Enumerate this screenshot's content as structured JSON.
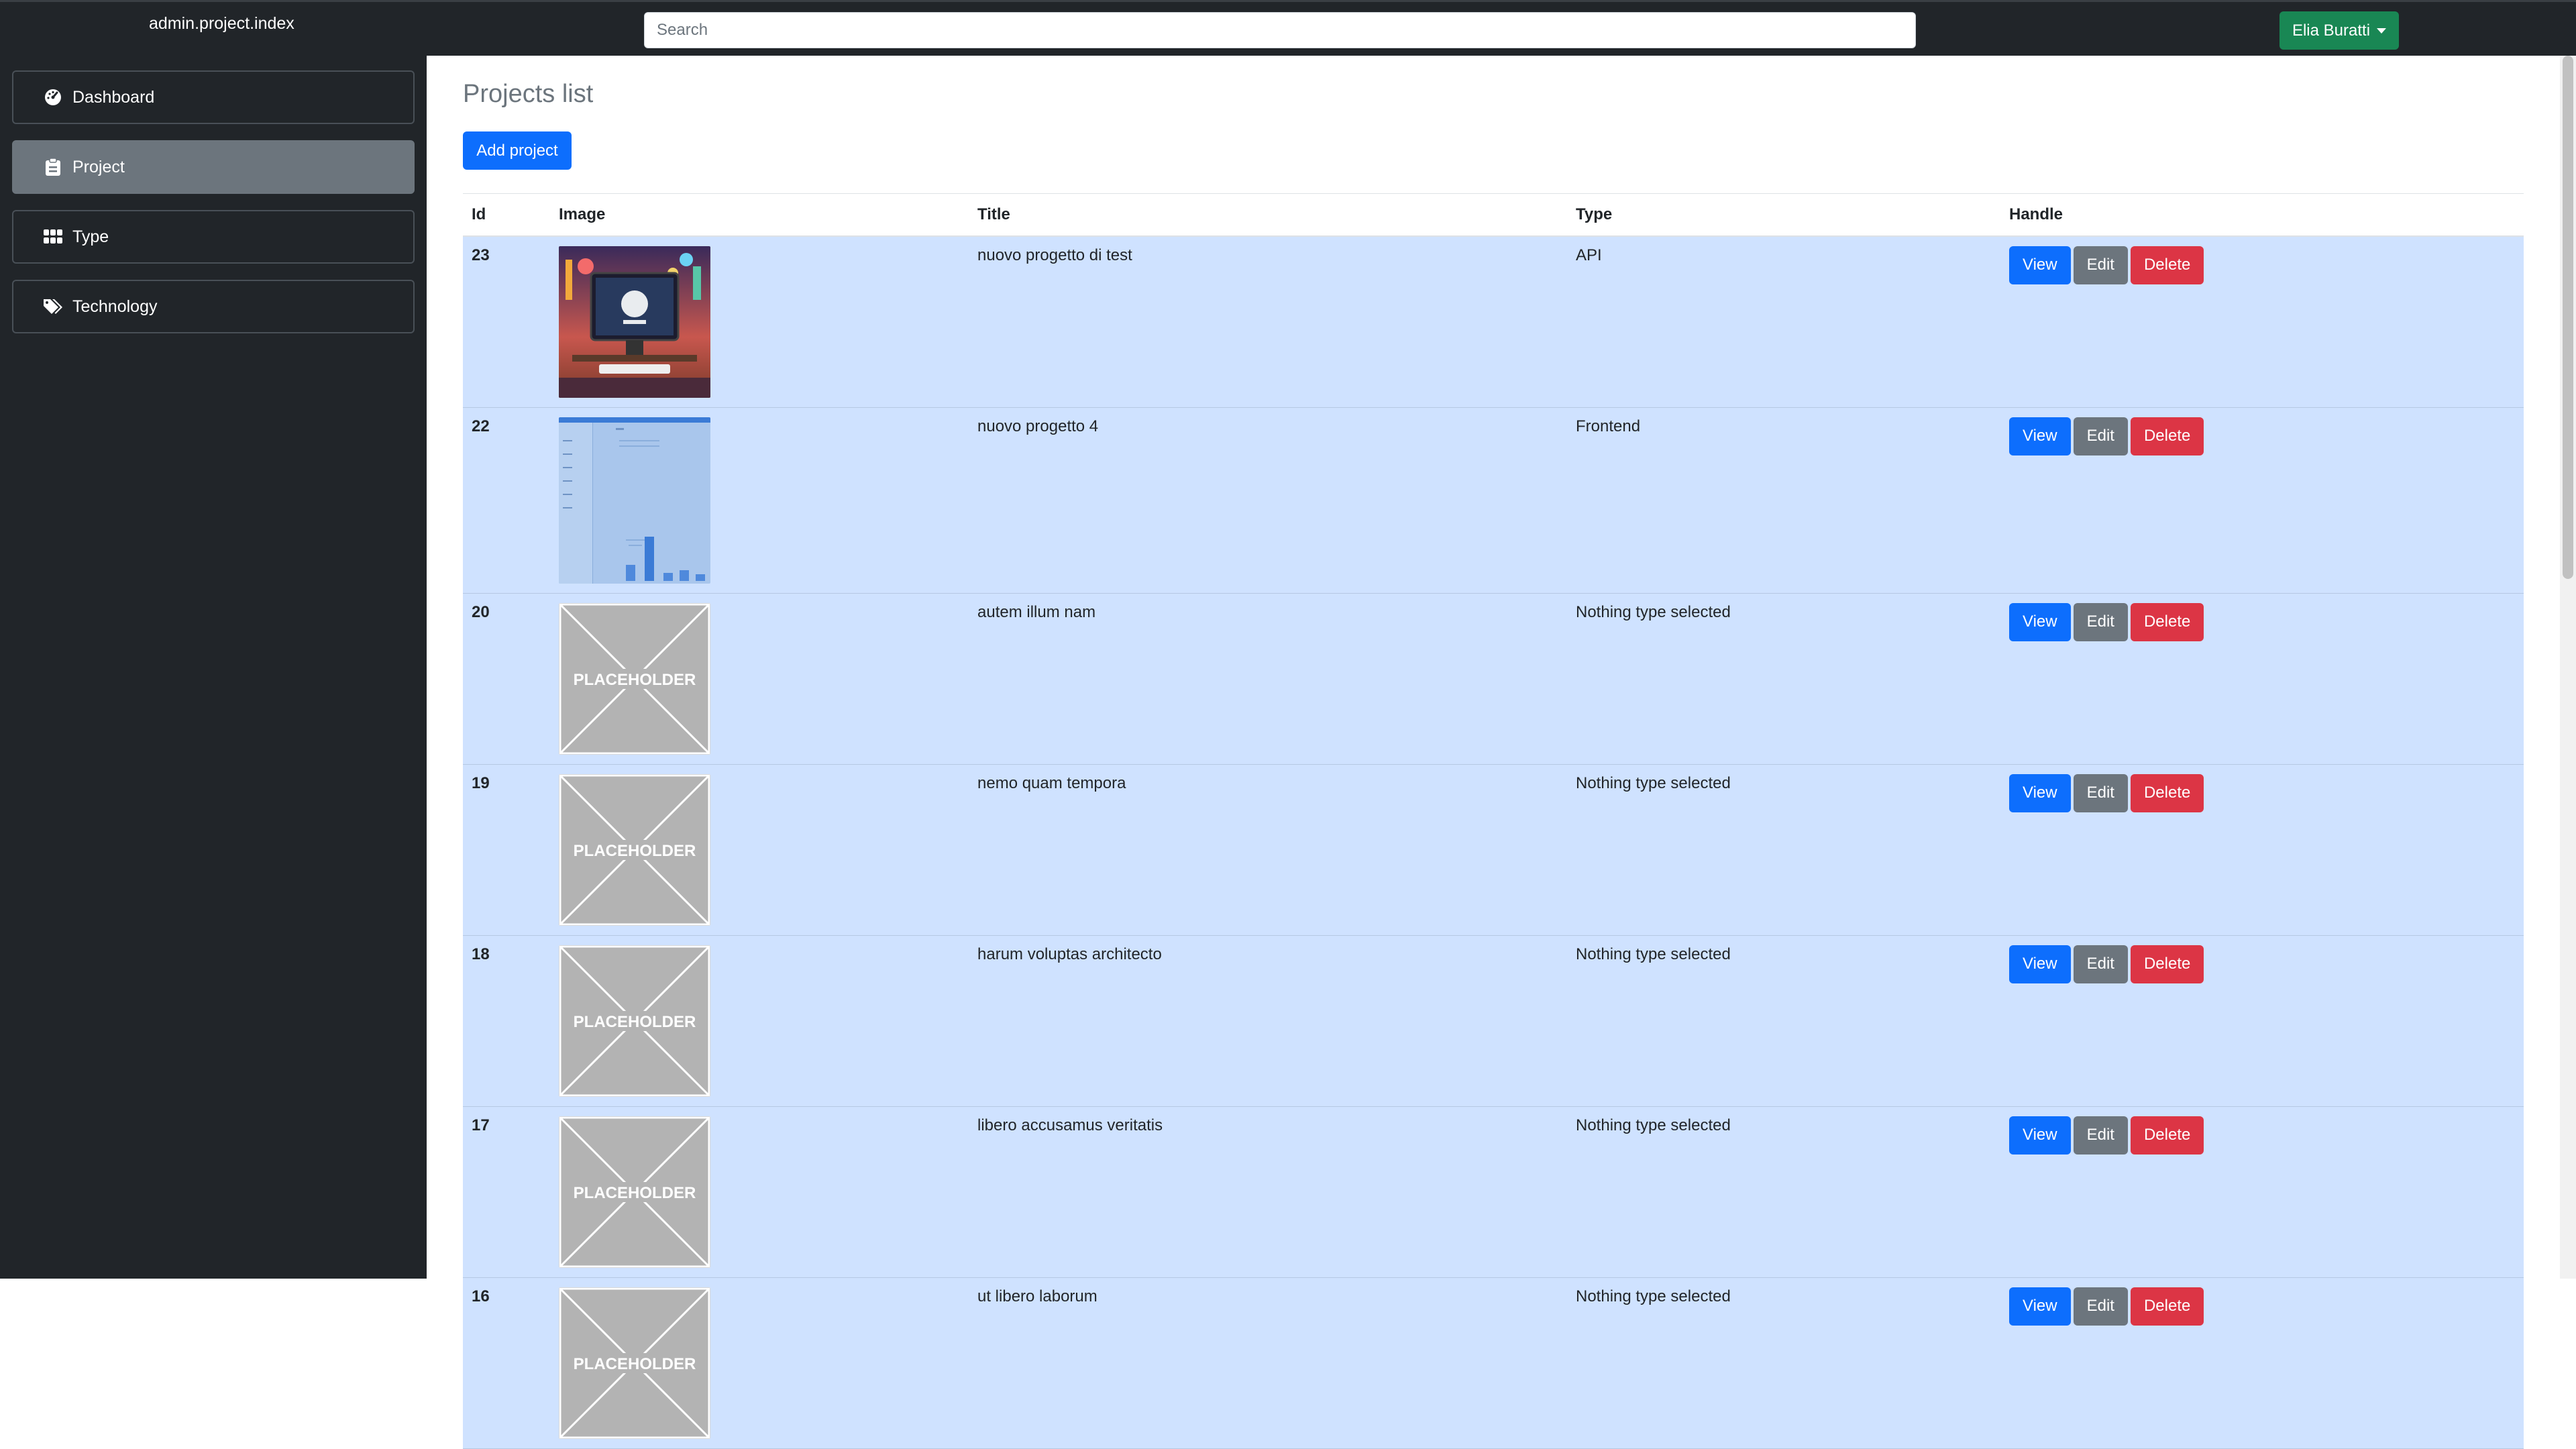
{
  "navbar": {
    "brand": "admin.project.index",
    "search_placeholder": "Search",
    "user_name": "Elia Buratti"
  },
  "sidebar": {
    "items": [
      {
        "label": "Dashboard",
        "icon": "gauge-icon",
        "active": false
      },
      {
        "label": "Project",
        "icon": "clipboard-icon",
        "active": true
      },
      {
        "label": "Type",
        "icon": "grid-icon",
        "active": false
      },
      {
        "label": "Technology",
        "icon": "tags-icon",
        "active": false
      }
    ]
  },
  "main": {
    "title": "Projects list",
    "add_button": "Add project",
    "columns": [
      "Id",
      "Image",
      "Title",
      "Type",
      "Handle"
    ],
    "buttons": {
      "view": "View",
      "edit": "Edit",
      "delete": "Delete"
    },
    "placeholder_text": "PLACEHOLDER",
    "rows": [
      {
        "id": "23",
        "image": "github-desk-image",
        "title": "nuovo progetto di test",
        "type": "API"
      },
      {
        "id": "22",
        "image": "dashboard-screenshot-image",
        "title": "nuovo progetto 4",
        "type": "Frontend"
      },
      {
        "id": "20",
        "image": "placeholder-image",
        "title": "autem illum nam",
        "type": "Nothing type selected"
      },
      {
        "id": "19",
        "image": "placeholder-image",
        "title": "nemo quam tempora",
        "type": "Nothing type selected"
      },
      {
        "id": "18",
        "image": "placeholder-image",
        "title": "harum voluptas architecto",
        "type": "Nothing type selected"
      },
      {
        "id": "17",
        "image": "placeholder-image",
        "title": "libero accusamus veritatis",
        "type": "Nothing type selected"
      },
      {
        "id": "16",
        "image": "placeholder-image",
        "title": "ut libero laborum",
        "type": "Nothing type selected"
      }
    ]
  },
  "colors": {
    "navbar_bg": "#212529",
    "primary": "#0d6efd",
    "secondary": "#6c757d",
    "danger": "#dc3545",
    "success": "#198754",
    "row_bg": "#cfe2ff"
  }
}
